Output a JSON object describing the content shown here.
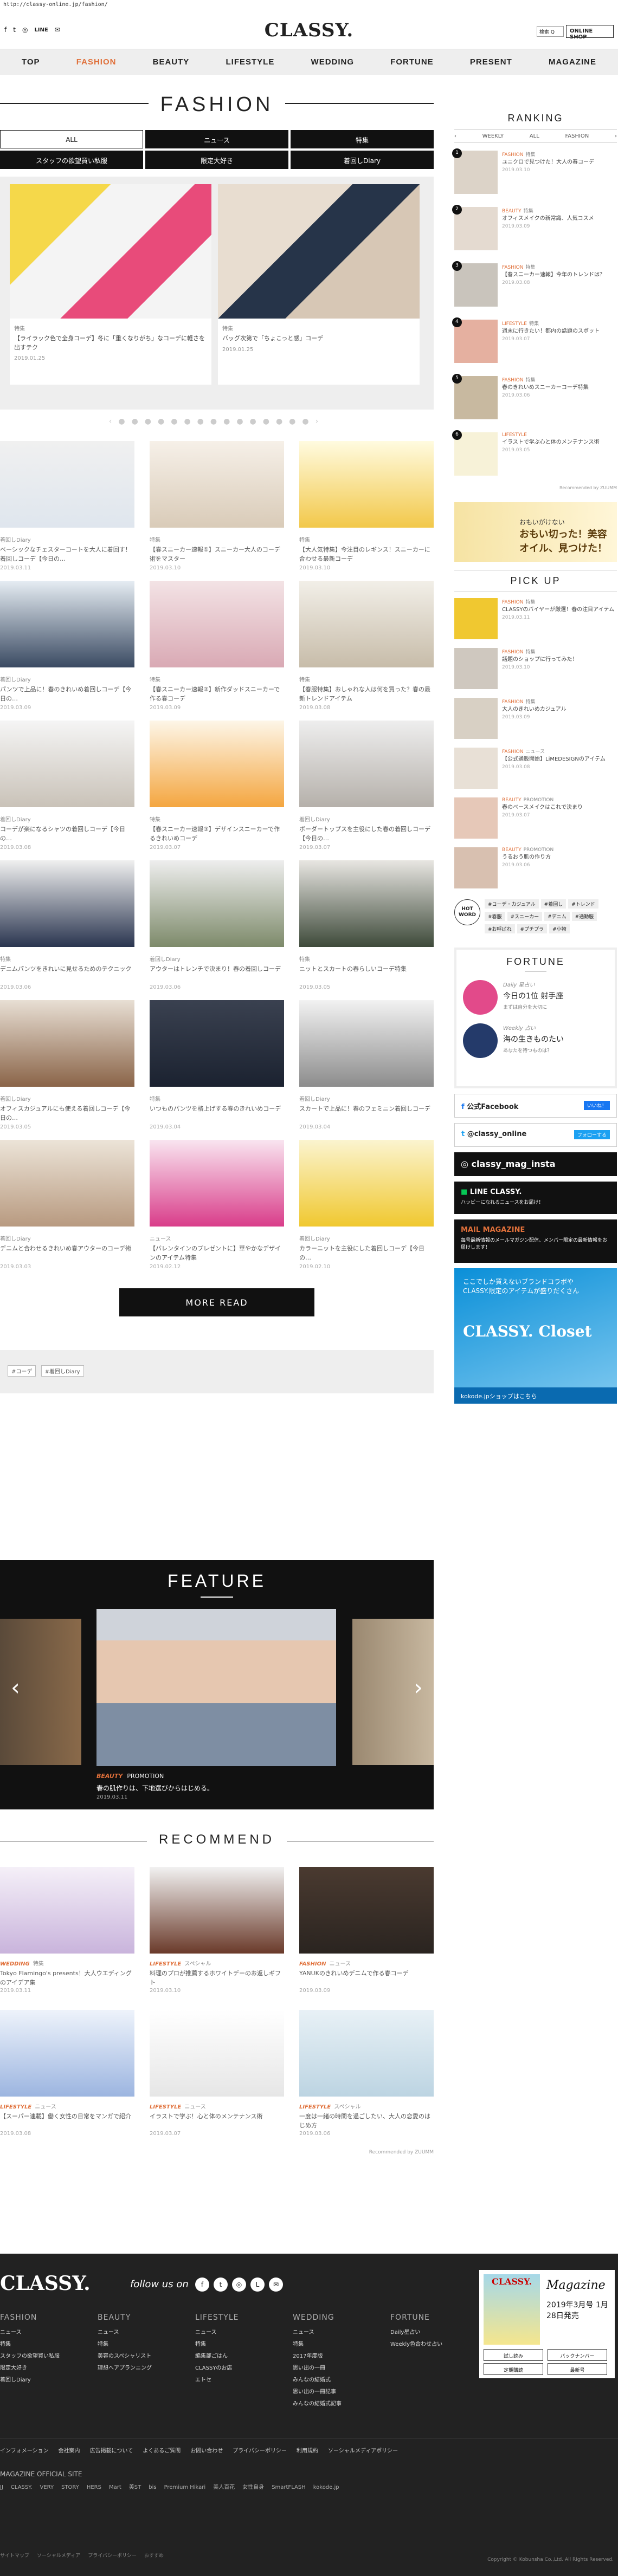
{
  "url": "http://classy-online.jp/fashion/",
  "header": {
    "logo": "CLASSY.",
    "social": [
      "f",
      "t",
      "ig",
      "LINE",
      "mail"
    ],
    "search_label": "検索 Q",
    "shop_label": "ONLINE SHOP"
  },
  "nav": [
    "TOP",
    "FASHION",
    "BEAUTY",
    "LIFESTYLE",
    "WEDDING",
    "FORTUNE",
    "PRESENT",
    "MAGAZINE"
  ],
  "nav_active": "FASHION",
  "page_title": "FASHION",
  "filters": [
    "ALL",
    "ニュース",
    "特集",
    "スタッフの欲望買い私服",
    "限定大好き",
    "着回しDiary"
  ],
  "slider": [
    {
      "cat": "特集",
      "title": "【ライラック色で全身コーデ】冬に「重くなりがち」なコーデに軽さを出すテク",
      "date": "2019.01.25"
    },
    {
      "cat": "特集",
      "title": "バッグ次第で「ちょこっと感」コーデ",
      "date": "2019.01.25"
    }
  ],
  "articles": [
    {
      "cat": "着回しDiary",
      "title": "ベーシックなチェスターコートを大人に着回す！着回しコーデ【今日の…",
      "date": "2019.03.11"
    },
    {
      "cat": "特集",
      "title": "【春スニーカー速報①】スニーカー大人のコーデ術をマスター",
      "date": "2019.03.10"
    },
    {
      "cat": "特集",
      "title": "【大人気特集】今注目のレギンス！スニーカーに合わせる最新コーデ",
      "date": "2019.03.10"
    },
    {
      "cat": "着回しDiary",
      "title": "パンツで上品に！春のきれいめ着回しコーデ【今日の…",
      "date": "2019.03.09"
    },
    {
      "cat": "特集",
      "title": "【春スニーカー速報②】新作ダッドスニーカーで作る春コーデ",
      "date": "2019.03.09"
    },
    {
      "cat": "特集",
      "title": "【春服特集】おしゃれな人は何を買った？春の最新トレンドアイテム",
      "date": "2019.03.08"
    },
    {
      "cat": "着回しDiary",
      "title": "コーデが楽になるシャツの着回しコーデ【今日の…",
      "date": "2019.03.08"
    },
    {
      "cat": "特集",
      "title": "【春スニーカー速報③】デザインスニーカーで作るきれいめコーデ",
      "date": "2019.03.07"
    },
    {
      "cat": "着回しDiary",
      "title": "ボーダートップスを主役にした春の着回しコーデ【今日の…",
      "date": "2019.03.07"
    },
    {
      "cat": "特集",
      "title": "デニムパンツをきれいに見せるためのテクニック",
      "date": "2019.03.06"
    },
    {
      "cat": "着回しDiary",
      "title": "アウターはトレンチで決まり！春の着回しコーデ",
      "date": "2019.03.06"
    },
    {
      "cat": "特集",
      "title": "ニットとスカートの春らしいコーデ特集",
      "date": "2019.03.05"
    },
    {
      "cat": "着回しDiary",
      "title": "オフィスカジュアルにも使える着回しコーデ【今日の…",
      "date": "2019.03.05"
    },
    {
      "cat": "特集",
      "title": "いつものパンツを格上げする春のきれいめコーデ",
      "date": "2019.03.04"
    },
    {
      "cat": "着回しDiary",
      "title": "スカートで上品に！春のフェミニン着回しコーデ",
      "date": "2019.03.04"
    },
    {
      "cat": "着回しDiary",
      "title": "デニムと合わせるきれいめ春アウターのコーデ術",
      "date": "2019.03.03"
    },
    {
      "cat": "ニュース",
      "title": "【バレンタインのプレゼントに】華やかなデザインのアイテム特集",
      "date": "2019.02.12"
    },
    {
      "cat": "着回しDiary",
      "title": "カラーニットを主役にした着回しコーデ【今日の…",
      "date": "2019.02.10"
    }
  ],
  "more_label": "MORE READ",
  "tags": [
    "#コーデ",
    "#着回しDiary"
  ],
  "feature": {
    "title": "FEATURE",
    "cat": "BEAUTY",
    "sub": "PROMOTION",
    "caption": "春の肌作りは、下地選びからはじめる。",
    "date": "2019.03.11"
  },
  "recommend": {
    "title": "RECOMMEND",
    "items": [
      {
        "cat": "WEDDING",
        "sub": "特集",
        "title": "Tokyo Flamingo's presents！大人ウエディングのアイデア集",
        "date": "2019.03.11"
      },
      {
        "cat": "LIFESTYLE",
        "sub": "スペシャル",
        "title": "料理のプロが推薦するホワイトデーのお返しギフト",
        "date": "2019.03.10"
      },
      {
        "cat": "FASHION",
        "sub": "ニュース",
        "title": "YANUKのきれいめデニムで作る春コーデ",
        "date": "2019.03.09"
      },
      {
        "cat": "LIFESTYLE",
        "sub": "ニュース",
        "title": "【スーパー連載】働く女性の日常をマンガで紹介",
        "date": "2019.03.08"
      },
      {
        "cat": "LIFESTYLE",
        "sub": "ニュース",
        "title": "イラストで学ぶ！心と体のメンテナンス術",
        "date": "2019.03.07"
      },
      {
        "cat": "LIFESTYLE",
        "sub": "スペシャル",
        "title": "一度は一緒の時間を過ごしたい、大人の恋愛のはじめ方",
        "date": "2019.03.06"
      }
    ],
    "powered": "Recommended by ZUUMM"
  },
  "ranking": {
    "title": "RANKING",
    "tabs": [
      "WEEKLY",
      "ALL",
      "FASHION"
    ],
    "items": [
      {
        "cat": "FASHION",
        "sub": "特集",
        "title": "ユニクロで見つけた！大人の春コーデ",
        "date": "2019.03.10"
      },
      {
        "cat": "BEAUTY",
        "sub": "特集",
        "title": "オフィスメイクの新常識、人気コスメ",
        "date": "2019.03.09"
      },
      {
        "cat": "FASHION",
        "sub": "特集",
        "title": "【春スニーカー速報】今年のトレンドは？",
        "date": "2019.03.08"
      },
      {
        "cat": "LIFESTYLE",
        "sub": "特集",
        "title": "週末に行きたい！都内の話題のスポット",
        "date": "2019.03.07"
      },
      {
        "cat": "FASHION",
        "sub": "特集",
        "title": "春のきれいめスニーカーコーデ特集",
        "date": "2019.03.06"
      },
      {
        "cat": "LIFESTYLE",
        "sub": "",
        "title": "イラストで学ぶ心と体のメンテナンス術",
        "date": "2019.03.05"
      }
    ],
    "powered": "Recommended by ZUUMM"
  },
  "ad1": {
    "small": "おもいがけない",
    "big": "おもい切った！美容オイル、見つけた！"
  },
  "pickup": {
    "title": "PICK UP",
    "items": [
      {
        "cat": "FASHION",
        "sub": "特集",
        "title": "CLASSYのバイヤーが厳選！春の注目アイテム",
        "date": "2019.03.11"
      },
      {
        "cat": "FASHION",
        "sub": "特集",
        "title": "話題のショップに行ってみた！",
        "date": "2019.03.10"
      },
      {
        "cat": "FASHION",
        "sub": "特集",
        "title": "大人のきれいめカジュアル",
        "date": "2019.03.09"
      },
      {
        "cat": "FASHION",
        "sub": "ニュース",
        "title": "【公式通販開始】LiMEDESIGNのアイテム",
        "date": "2019.03.08"
      },
      {
        "cat": "BEAUTY",
        "sub": "PROMOTION",
        "title": "春のベースメイクはこれで決まり",
        "date": "2019.03.07"
      },
      {
        "cat": "BEAUTY",
        "sub": "PROMOTION",
        "title": "うるおう肌の作り方",
        "date": "2019.03.06"
      }
    ]
  },
  "hotword": {
    "label": "HOT WORD",
    "tags": [
      "#コーデ・カジュアル",
      "#着回し",
      "#トレンド",
      "#春服",
      "#スニーカー",
      "#デニム",
      "#通勤服",
      "#お呼ばれ",
      "#プチプラ",
      "#小物"
    ]
  },
  "fortune": {
    "title": "FORTUNE",
    "daily_label": "Daily 星占い",
    "daily_sign": "今日の1位 射手座",
    "daily_note": "まずは自分を大切に",
    "weekly_label": "Weekly 占い",
    "weekly_sign": "海の生きものたい",
    "weekly_note": "あなたを待つものは？"
  },
  "socialbtns": {
    "facebook": "公式Facebook",
    "facebook_sub": "いいね！",
    "twitter": "@classy_online",
    "twitter_sub": "フォローする",
    "instagram": "classy_mag_insta",
    "line": "LINE CLASSY.",
    "line_sub": "ハッピーになれるニュースをお届け！",
    "mail": "MAIL MAGAZINE",
    "mail_sub": "毎号最新情報のメールマガジン配信、メンバー限定の最新情報をお届けします！"
  },
  "ad2": {
    "line1": "ここでしか買えないブランドコラボや",
    "line2": "CLASSY.限定のアイテムが盛りだくさん",
    "big": "CLASSY. Closet",
    "foot": "kokode.jpショップはこちら"
  },
  "footer": {
    "logo": "CLASSY.",
    "follow": "follow us on",
    "cols": [
      {
        "head": "FASHION",
        "items": [
          "ニュース",
          "特集",
          "スタッフの欲望買い私服",
          "限定大好き",
          "着回しDiary"
        ]
      },
      {
        "head": "BEAUTY",
        "items": [
          "ニュース",
          "特集",
          "美容のスペシャリスト",
          "理想へアプランニング"
        ]
      },
      {
        "head": "LIFESTYLE",
        "items": [
          "ニュース",
          "特集",
          "編集部ごはん",
          "CLASSYのお店",
          "エトセ"
        ]
      },
      {
        "head": "WEDDING",
        "items": [
          "ニュース",
          "特集",
          "2017年度版",
          "思い出の一冊",
          "みんなの結婚式",
          "思い出の一冊記事",
          "みんなの結婚式記事"
        ]
      },
      {
        "head": "FORTUNE",
        "items": [
          "Daily星占い",
          "Weekly色合わせ占い"
        ]
      }
    ],
    "magazine": {
      "title": "Magazine",
      "date": "2019年3月号 1月28日発売",
      "btn1": "試し読み",
      "btn2": "バックナンバー",
      "btn3": "定期購読",
      "btn4": "最新号"
    },
    "links": [
      "インフォメーション",
      "会社案内",
      "広告掲載について",
      "よくあるご質問",
      "お問い合わせ",
      "プライバシーポリシー",
      "利用規約",
      "ソーシャルメディアポリシー"
    ],
    "sites_title": "MAGAZINE OFFICIAL SITE",
    "sites": [
      "JJ",
      "CLASSY.",
      "VERY",
      "STORY",
      "HERS",
      "Mart",
      "美ST",
      "bis",
      "Premium Hikari",
      "美人百花",
      "女性自身",
      "SmartFLASH",
      "kokode.jp"
    ],
    "bottom": [
      "サイトマップ",
      "ソーシャルメディア",
      "プライバシーポリシー",
      "おすすめ"
    ],
    "copyright": "Copyright © Kobunsha Co.,Ltd. All Rights Reserved."
  }
}
